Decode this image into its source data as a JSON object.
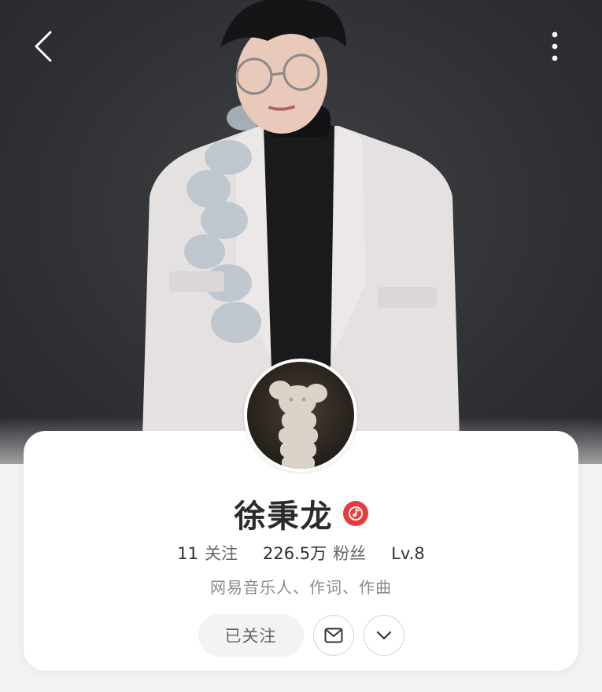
{
  "header": {
    "back_icon": "chevron-left-icon",
    "more_icon": "vertical-ellipsis-icon"
  },
  "profile": {
    "name": "徐秉龙",
    "verified_icon": "music-note-badge-icon",
    "verified_color": "#e83b3b",
    "following_count": "11",
    "following_label": "关注",
    "fans_count": "226.5万",
    "fans_label": "粉丝",
    "level": "Lv.8",
    "bio": "网易音乐人、作词、作曲"
  },
  "actions": {
    "followed_label": "已关注",
    "message_icon": "mail-icon",
    "expand_icon": "chevron-down-icon"
  }
}
